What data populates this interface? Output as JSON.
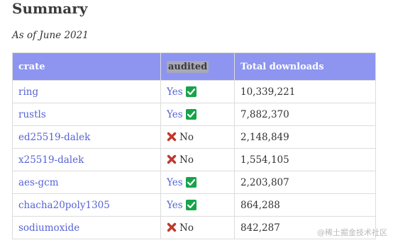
{
  "title": "Summary",
  "subtitle": "As of June 2021",
  "table": {
    "headers": [
      "crate",
      "audited",
      "Total downloads"
    ],
    "rows": [
      {
        "crate": "ring",
        "audited": true,
        "audited_label": "Yes",
        "downloads": "10,339,221"
      },
      {
        "crate": "rustls",
        "audited": true,
        "audited_label": "Yes",
        "downloads": "7,882,370"
      },
      {
        "crate": "ed25519-dalek",
        "audited": false,
        "audited_label": "No",
        "downloads": "2,148,849"
      },
      {
        "crate": "x25519-dalek",
        "audited": false,
        "audited_label": "No",
        "downloads": "1,554,105"
      },
      {
        "crate": "aes-gcm",
        "audited": true,
        "audited_label": "Yes",
        "downloads": "2,203,807"
      },
      {
        "crate": "chacha20poly1305",
        "audited": true,
        "audited_label": "Yes",
        "downloads": "864,288"
      },
      {
        "crate": "sodiumoxide",
        "audited": false,
        "audited_label": "No",
        "downloads": "842,287"
      }
    ]
  },
  "watermark": "@稀土掘金技术社区",
  "colors": {
    "header_bg": "#8d95f1",
    "link": "#5563d6",
    "check_bg": "#17a34a",
    "cross": "#c0392b"
  },
  "icons": {
    "yes": "check-mark-icon",
    "no": "cross-mark-icon"
  }
}
